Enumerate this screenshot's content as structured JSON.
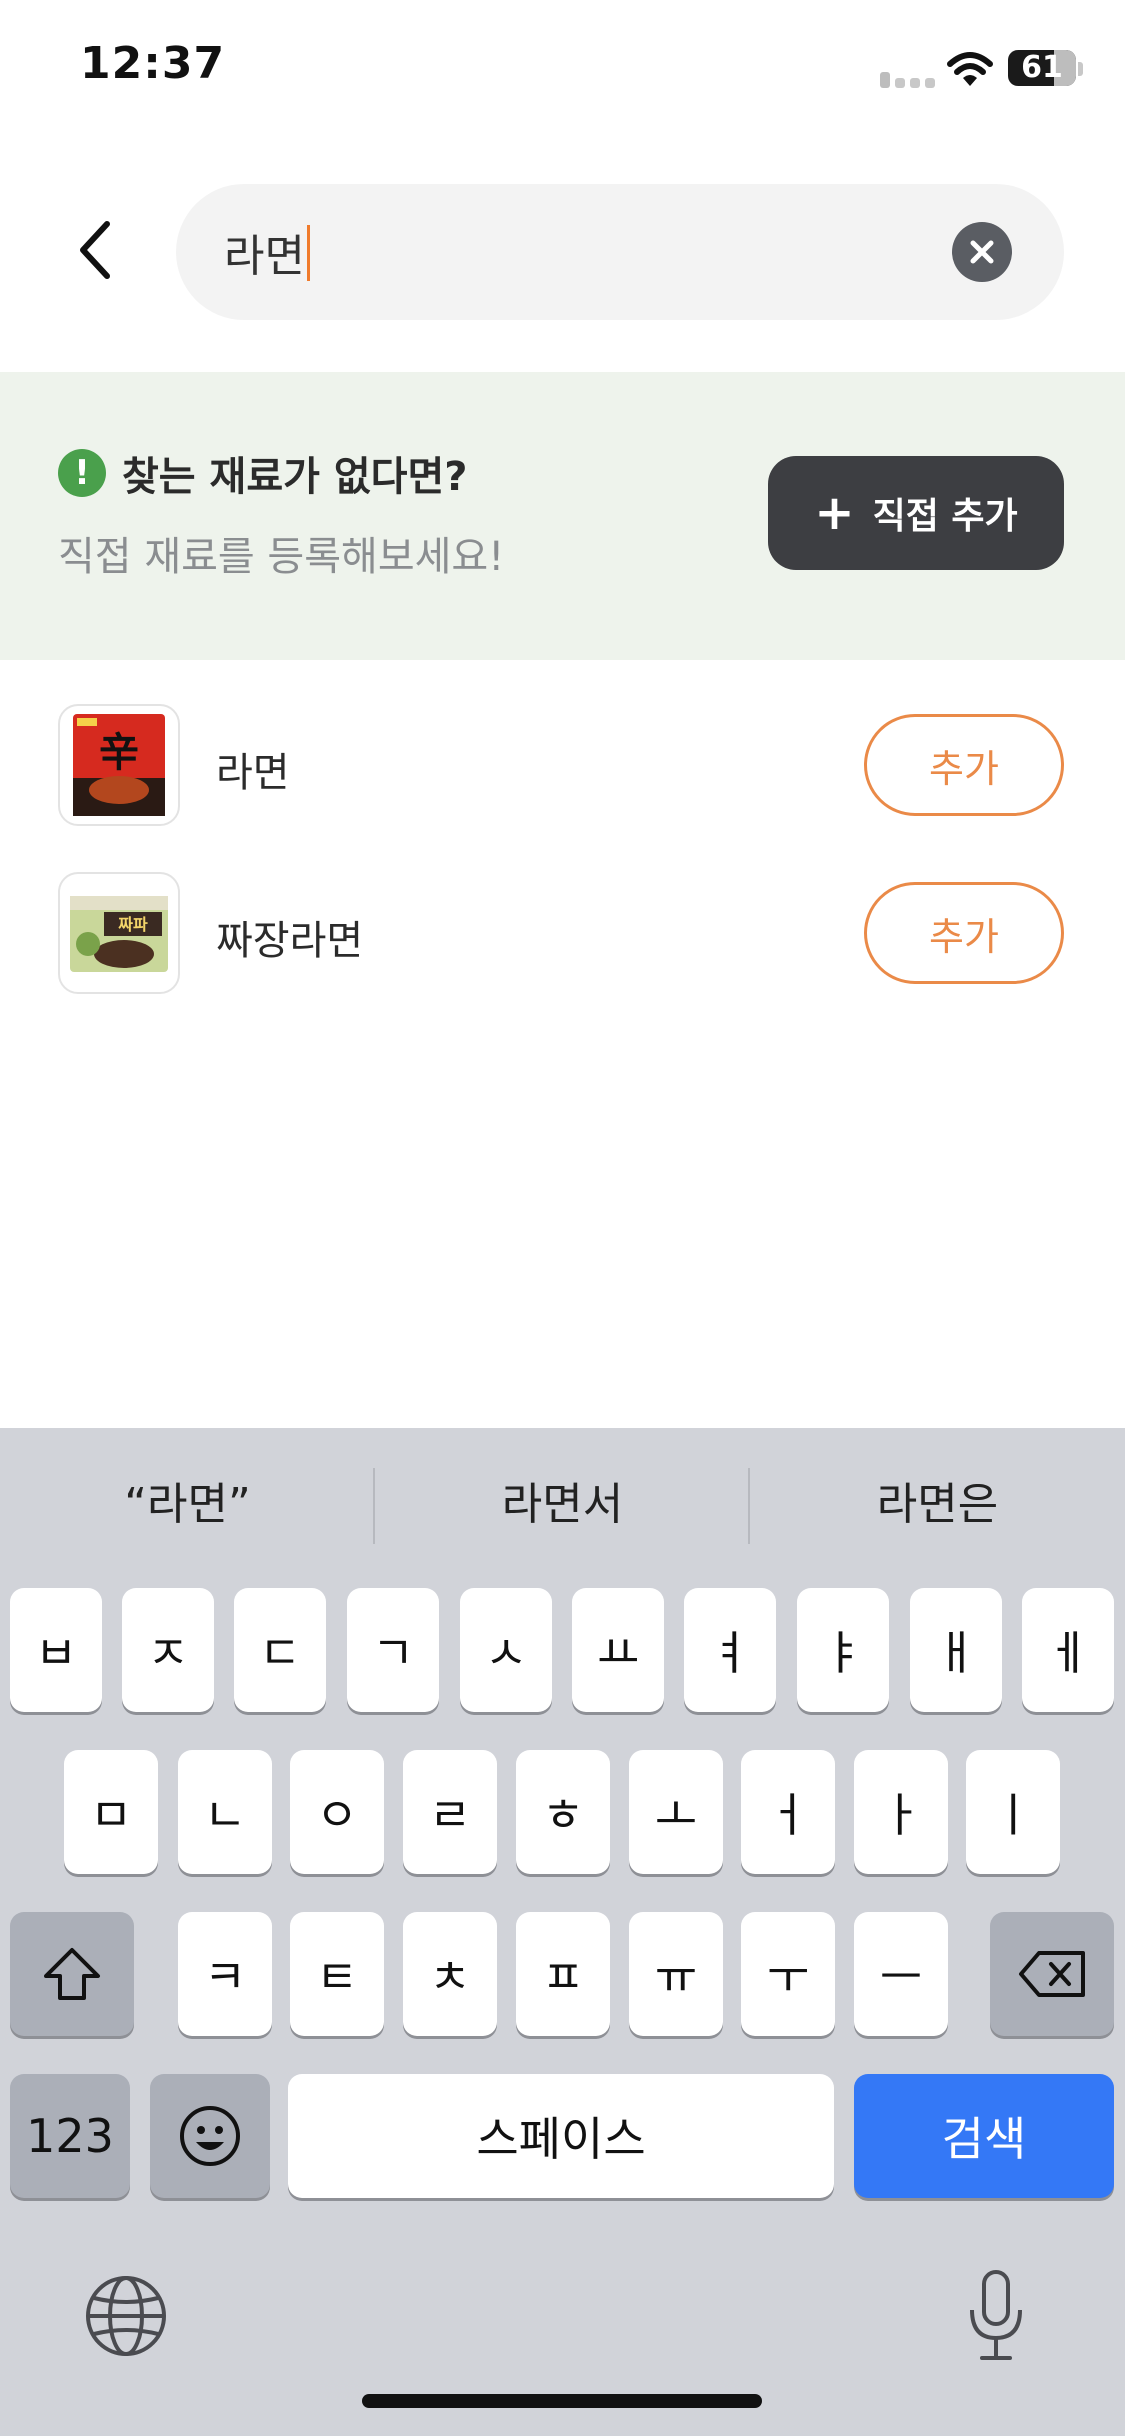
{
  "status_bar": {
    "time": "12:37",
    "battery": "61"
  },
  "search": {
    "value": "라면",
    "placeholder": ""
  },
  "banner": {
    "title": "찾는 재료가 없다면?",
    "subtitle": "직접 재료를 등록해보세요!",
    "button_label": "직접 추가",
    "button_icon": "plus-icon"
  },
  "results": [
    {
      "name": "라면",
      "add_label": "추가"
    },
    {
      "name": "짜장라면",
      "add_label": "추가"
    }
  ],
  "keyboard": {
    "suggestions": [
      "“라면”",
      "라면서",
      "라면은"
    ],
    "row1": [
      "ㅂ",
      "ㅈ",
      "ㄷ",
      "ㄱ",
      "ㅅ",
      "ㅛ",
      "ㅕ",
      "ㅑ",
      "ㅐ",
      "ㅔ"
    ],
    "row2": [
      "ㅁ",
      "ㄴ",
      "ㅇ",
      "ㄹ",
      "ㅎ",
      "ㅗ",
      "ㅓ",
      "ㅏ",
      "ㅣ"
    ],
    "row3": [
      "ㅋ",
      "ㅌ",
      "ㅊ",
      "ㅍ",
      "ㅠ",
      "ㅜ",
      "ㅡ"
    ],
    "numbers_label": "123",
    "space_label": "스페이스",
    "return_label": "검색"
  },
  "colors": {
    "accent": "#ea8a48",
    "banner_bg": "#eef3ec",
    "keyboard_blue": "#3478f6"
  }
}
